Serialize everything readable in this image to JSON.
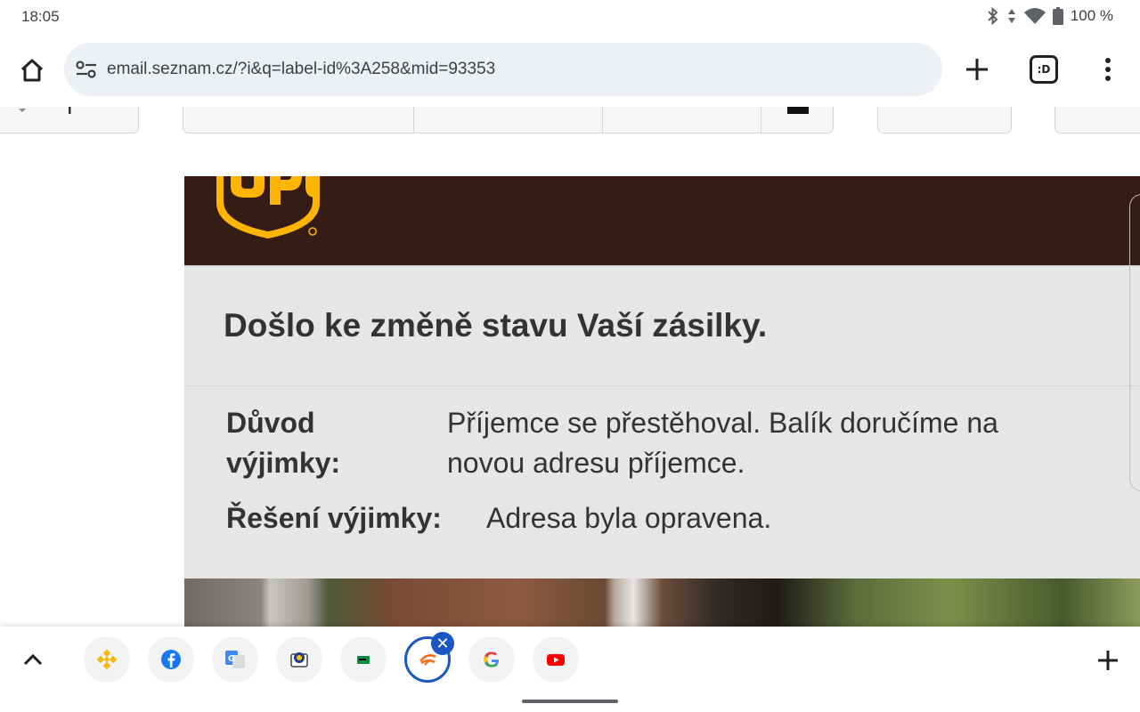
{
  "status": {
    "time": "18:05",
    "battery": "100 %",
    "icons": [
      "bluetooth-icon",
      "data-arrows-icon",
      "wifi-icon",
      "battery-icon"
    ]
  },
  "toolbar": {
    "url": "email.seznam.cz/?i&q=label-id%3A258&mid=93353",
    "tab_count": ":D"
  },
  "email": {
    "headline": "Došlo ke změně stavu Vaší zásilky.",
    "reason_label_line1": "Důvod",
    "reason_label_line2": "výjimky:",
    "reason_value_line1": "Příjemce se přestěhoval. Balík doručíme na",
    "reason_value_line2": "novou adresu příjemce.",
    "solution_label": "Řešení výjimky:",
    "solution_value": "Adresa byla opravena.",
    "brand": "ups",
    "colors": {
      "brand_brown": "#351c15",
      "brand_gold": "#ffb500",
      "panel_gray": "#e6e6e6"
    }
  },
  "bottom_tabs": [
    {
      "name": "binance-tab",
      "icon": "binance-icon"
    },
    {
      "name": "facebook-tab",
      "icon": "facebook-icon"
    },
    {
      "name": "translate-tab",
      "icon": "google-translate-icon"
    },
    {
      "name": "mail-tab",
      "icon": "mail-icon"
    },
    {
      "name": "green-tab",
      "icon": "green-card-icon"
    },
    {
      "name": "active-tab",
      "icon": "seznam-icon",
      "active": true
    },
    {
      "name": "google-tab",
      "icon": "google-icon"
    },
    {
      "name": "youtube-tab",
      "icon": "youtube-icon"
    }
  ]
}
